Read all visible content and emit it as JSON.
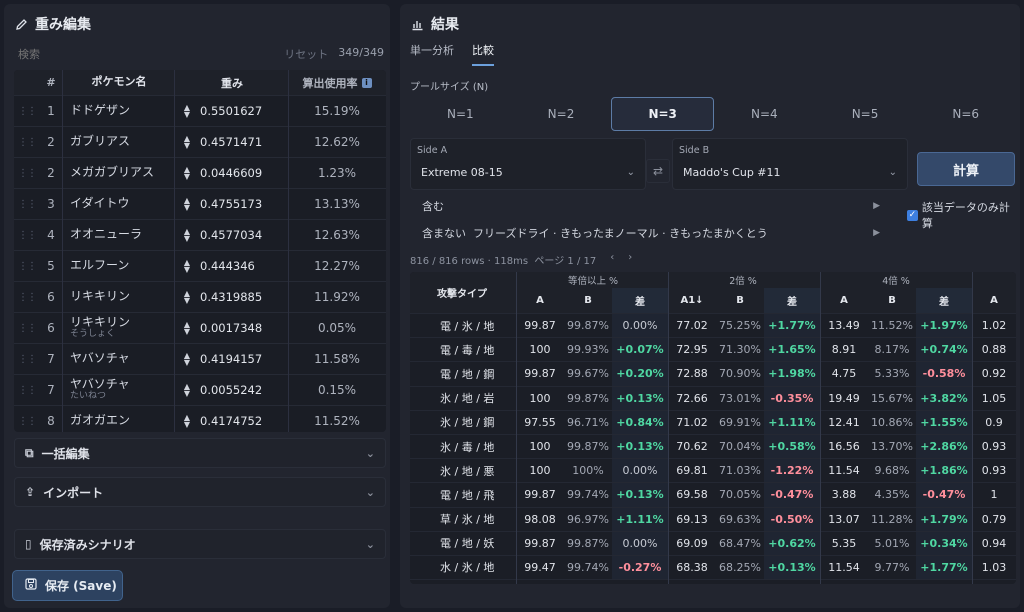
{
  "left": {
    "title": "重み編集",
    "search_placeholder": "検索",
    "reset": "リセット",
    "count": "349/349",
    "headers": {
      "num": "#",
      "name": "ポケモン名",
      "weight": "重み",
      "rate": "算出使用率"
    },
    "rows": [
      {
        "num": "1",
        "name": "ドドゲザン",
        "sub": "",
        "weight": "0.5501627",
        "rate": "15.19%"
      },
      {
        "num": "2",
        "name": "ガブリアス",
        "sub": "",
        "weight": "0.4571471",
        "rate": "12.62%"
      },
      {
        "num": "2",
        "name": "メガガブリアス",
        "sub": "",
        "weight": "0.0446609",
        "rate": "1.23%"
      },
      {
        "num": "3",
        "name": "イダイトウ",
        "sub": "",
        "weight": "0.4755173",
        "rate": "13.13%"
      },
      {
        "num": "4",
        "name": "オオニューラ",
        "sub": "",
        "weight": "0.4577034",
        "rate": "12.63%"
      },
      {
        "num": "5",
        "name": "エルフーン",
        "sub": "",
        "weight": "0.444346",
        "rate": "12.27%"
      },
      {
        "num": "6",
        "name": "リキキリン",
        "sub": "",
        "weight": "0.4319885",
        "rate": "11.92%"
      },
      {
        "num": "6",
        "name": "リキキリン",
        "sub": "そうしょく",
        "weight": "0.0017348",
        "rate": "0.05%"
      },
      {
        "num": "7",
        "name": "ヤバソチャ",
        "sub": "",
        "weight": "0.4194157",
        "rate": "11.58%"
      },
      {
        "num": "7",
        "name": "ヤバソチャ",
        "sub": "たいねつ",
        "weight": "0.0055242",
        "rate": "0.15%"
      },
      {
        "num": "8",
        "name": "ガオガエン",
        "sub": "",
        "weight": "0.4174752",
        "rate": "11.52%"
      }
    ],
    "bulk_edit": "一括編集",
    "import": "インポート",
    "saved_scenarios": "保存済みシナリオ",
    "save_button": "保存 (Save)"
  },
  "right": {
    "title": "結果",
    "tabs": [
      "単一分析",
      "比較"
    ],
    "active_tab": 1,
    "pool_label": "プールサイズ (N)",
    "n_options": [
      "N=1",
      "N=2",
      "N=3",
      "N=4",
      "N=5",
      "N=6"
    ],
    "n_selected": 2,
    "side_a": {
      "label": "Side A",
      "value": "Extreme 08-15"
    },
    "side_b": {
      "label": "Side B",
      "value": "Maddo's Cup #11"
    },
    "calc_button": "計算",
    "only_matching": "該当データのみ計算",
    "include_label": "含む",
    "exclude_label": "含まない",
    "exclude_items": "フリーズドライ · きもったまノーマル · きもったまかくとう",
    "rows_info": "816 / 816 rows · 118ms",
    "page_info": "ページ 1 / 17",
    "prev": "‹",
    "next": "›",
    "groups": [
      "等倍以上 %",
      "2倍 %",
      "4倍 %"
    ],
    "sub_headers": {
      "type": "攻撃タイプ",
      "a": "A",
      "b": "B",
      "diff": "差",
      "a_sorted": "A1↓"
    },
    "rows": [
      {
        "type": "電 / 氷 / 地",
        "g1": [
          "99.87",
          "99.87%",
          "0.00%"
        ],
        "g2": [
          "77.02",
          "75.25%",
          "+1.77%"
        ],
        "g3": [
          "13.49",
          "11.52%",
          "+1.97%"
        ],
        "g4": "1.02"
      },
      {
        "type": "電 / 毒 / 地",
        "g1": [
          "100",
          "99.93%",
          "+0.07%"
        ],
        "g2": [
          "72.95",
          "71.30%",
          "+1.65%"
        ],
        "g3": [
          "8.91",
          "8.17%",
          "+0.74%"
        ],
        "g4": "0.88"
      },
      {
        "type": "電 / 地 / 鋼",
        "g1": [
          "99.87",
          "99.67%",
          "+0.20%"
        ],
        "g2": [
          "72.88",
          "70.90%",
          "+1.98%"
        ],
        "g3": [
          "4.75",
          "5.33%",
          "-0.58%"
        ],
        "g4": "0.92"
      },
      {
        "type": "氷 / 地 / 岩",
        "g1": [
          "100",
          "99.87%",
          "+0.13%"
        ],
        "g2": [
          "72.66",
          "73.01%",
          "-0.35%"
        ],
        "g3": [
          "19.49",
          "15.67%",
          "+3.82%"
        ],
        "g4": "1.05"
      },
      {
        "type": "氷 / 地 / 鋼",
        "g1": [
          "97.55",
          "96.71%",
          "+0.84%"
        ],
        "g2": [
          "71.02",
          "69.91%",
          "+1.11%"
        ],
        "g3": [
          "12.41",
          "10.86%",
          "+1.55%"
        ],
        "g4": "0.9"
      },
      {
        "type": "氷 / 毒 / 地",
        "g1": [
          "100",
          "99.87%",
          "+0.13%"
        ],
        "g2": [
          "70.62",
          "70.04%",
          "+0.58%"
        ],
        "g3": [
          "16.56",
          "13.70%",
          "+2.86%"
        ],
        "g4": "0.93"
      },
      {
        "type": "氷 / 地 / 悪",
        "g1": [
          "100",
          "100%",
          "0.00%"
        ],
        "g2": [
          "69.81",
          "71.03%",
          "-1.22%"
        ],
        "g3": [
          "11.54",
          "9.68%",
          "+1.86%"
        ],
        "g4": "0.93"
      },
      {
        "type": "電 / 地 / 飛",
        "g1": [
          "99.87",
          "99.74%",
          "+0.13%"
        ],
        "g2": [
          "69.58",
          "70.05%",
          "-0.47%"
        ],
        "g3": [
          "3.88",
          "4.35%",
          "-0.47%"
        ],
        "g4": "1"
      },
      {
        "type": "草 / 氷 / 地",
        "g1": [
          "98.08",
          "96.97%",
          "+1.11%"
        ],
        "g2": [
          "69.13",
          "69.63%",
          "-0.50%"
        ],
        "g3": [
          "13.07",
          "11.28%",
          "+1.79%"
        ],
        "g4": "0.79"
      },
      {
        "type": "電 / 地 / 妖",
        "g1": [
          "99.87",
          "99.87%",
          "0.00%"
        ],
        "g2": [
          "69.09",
          "68.47%",
          "+0.62%"
        ],
        "g3": [
          "5.35",
          "5.01%",
          "+0.34%"
        ],
        "g4": "0.94"
      },
      {
        "type": "水 / 氷 / 地",
        "g1": [
          "99.47",
          "99.74%",
          "-0.27%"
        ],
        "g2": [
          "68.38",
          "68.25%",
          "+0.13%"
        ],
        "g3": [
          "11.54",
          "9.77%",
          "+1.77%"
        ],
        "g4": "1.03"
      }
    ]
  }
}
